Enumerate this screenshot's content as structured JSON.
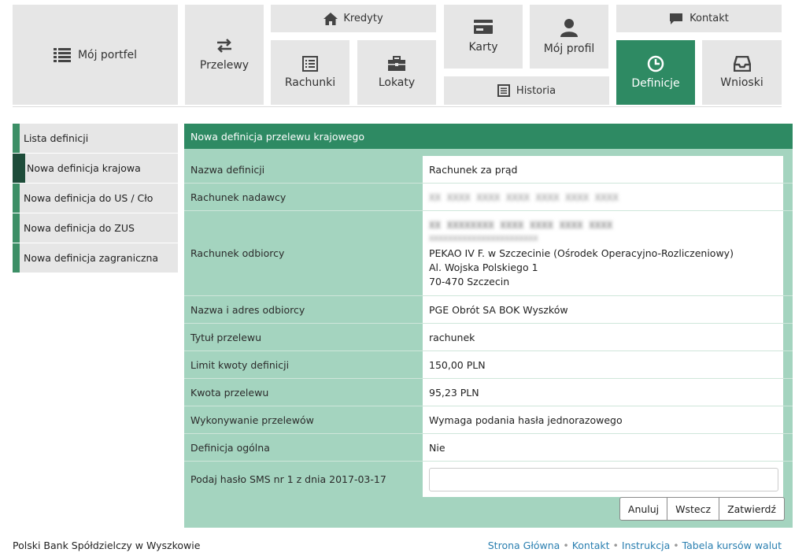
{
  "nav": {
    "portfolio": "Mój portfel",
    "transfers": "Przelewy",
    "loans": "Kredyty",
    "accounts": "Rachunki",
    "deposits": "Lokaty",
    "cards": "Karty",
    "history": "Historia",
    "profile": "Mój profil",
    "contact": "Kontakt",
    "definitions": "Definicje",
    "applications": "Wnioski"
  },
  "sidebar": {
    "items": [
      {
        "label": "Lista definicji"
      },
      {
        "label": "Nowa definicja krajowa"
      },
      {
        "label": "Nowa definicja do US / Cło"
      },
      {
        "label": "Nowa definicja do ZUS"
      },
      {
        "label": "Nowa definicja zagraniczna"
      }
    ]
  },
  "panel": {
    "title": "Nowa definicja przelewu krajowego",
    "rows": [
      {
        "label": "Nazwa definicji",
        "value": "Rachunek za prąd"
      },
      {
        "label": "Rachunek nadawcy",
        "value": "XX XXXX XXXX XXXX XXXX XXXX XXXX"
      },
      {
        "label": "Rachunek odbiorcy",
        "value_lines": [
          "XX XXXXXXXX XXXX XXXX XXXX XXXX",
          "XXXXXXXXXXXXXXXXXXXXXXX",
          "PEKAO IV F. w Szczecinie (Ośrodek Operacyjno-Rozliczeniowy)",
          "Al. Wojska Polskiego 1",
          "70-470 Szczecin"
        ]
      },
      {
        "label": "Nazwa i adres odbiorcy",
        "value": "PGE Obrót SA BOK Wyszków"
      },
      {
        "label": "Tytuł przelewu",
        "value": "rachunek"
      },
      {
        "label": "Limit kwoty definicji",
        "value": "150,00 PLN"
      },
      {
        "label": "Kwota przelewu",
        "value": "95,23 PLN"
      },
      {
        "label": "Wykonywanie przelewów",
        "value": "Wymaga podania hasła jednorazowego"
      },
      {
        "label": "Definicja ogólna",
        "value": "Nie"
      },
      {
        "label": "Podaj hasło SMS nr 1 z dnia 2017-03-17",
        "input_value": ""
      }
    ],
    "buttons": {
      "cancel": "Anuluj",
      "back": "Wstecz",
      "confirm": "Zatwierdź"
    }
  },
  "footer": {
    "bank_name": "Polski Bank Spółdzielczy w Wyszkowie",
    "links": [
      "Strona Główna",
      "Kontakt",
      "Instrukcja",
      "Tabela kursów walut"
    ],
    "separator": "•"
  },
  "colors": {
    "accent": "#2e8a63",
    "panel_bg": "#a4d4bf",
    "tile_bg": "#e6e6e6",
    "link": "#2a7fb0"
  },
  "icons": [
    "list-icon",
    "transfer-arrows-icon",
    "home-icon",
    "ledger-icon",
    "briefcase-icon",
    "credit-card-icon",
    "history-list-icon",
    "user-icon",
    "chat-icon",
    "clock-icon",
    "inbox-icon"
  ]
}
